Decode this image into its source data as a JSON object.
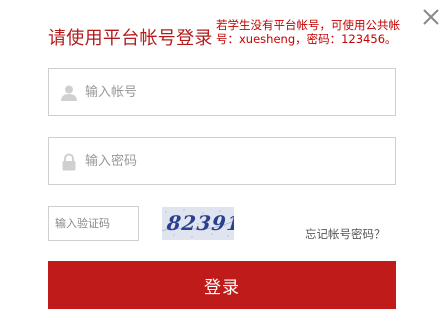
{
  "dialog": {
    "title": "请使用平台帐号登录",
    "notice": "若学生没有平台帐号，可使用公共帐\n号：xuesheng，密码：123456。",
    "close_icon": "close-icon"
  },
  "form": {
    "username_placeholder": "输入帐号",
    "password_placeholder": "输入密码",
    "captcha_placeholder": "输入验证码",
    "captcha_code": "82391",
    "forgot_label": "忘记帐号密码？",
    "login_label": "登录"
  },
  "icons": {
    "username": "user-icon",
    "password": "lock-icon"
  },
  "colors": {
    "accent": "#c01b1b",
    "title": "#b31b1b",
    "notice": "#c40000",
    "border": "#cfcfcf",
    "icon": "#d0d0d0"
  }
}
